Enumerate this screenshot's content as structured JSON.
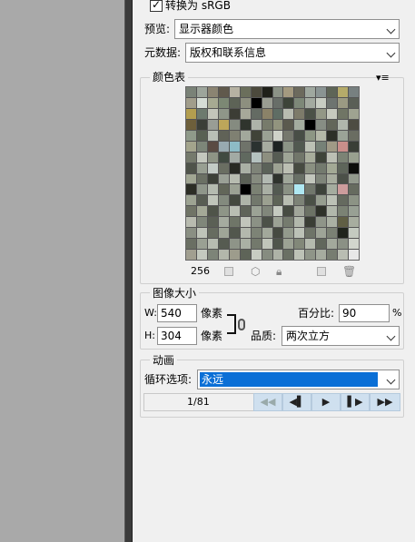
{
  "convert": {
    "label": "转换为 sRGB",
    "checked": "✓"
  },
  "preview": {
    "label": "预览:",
    "value": "显示器颜色"
  },
  "metadata": {
    "label": "元数据:",
    "value": "版权和联系信息"
  },
  "colorTable": {
    "title": "颜色表",
    "menuIcon": "≡",
    "count": "256",
    "colors": [
      "#7a8277",
      "#9da59b",
      "#8b8472",
      "#60594c",
      "#b6b2a2",
      "#6b6f5c",
      "#4c4a3d",
      "#1f2019",
      "#8b9286",
      "#a49a80",
      "#6c6a5d",
      "#9fa89f",
      "#8a9493",
      "#5e6557",
      "#b5ab6a",
      "#778080",
      "#a19d8b",
      "#d6ddd6",
      "#a7aa92",
      "#7c8874",
      "#5d6356",
      "#8d8f7f",
      "#000000",
      "#9a9d92",
      "#686e68",
      "#3d4439",
      "#7d8878",
      "#a3aaa0",
      "#c8cdc3",
      "#6e7470",
      "#9b9a83",
      "#5a5f56",
      "#b39e4f",
      "#6d7a6e",
      "#c3c5ba",
      "#8f9689",
      "#3c3d35",
      "#a7a89a",
      "#646b63",
      "#8b8268",
      "#5f6d64",
      "#b8bcb1",
      "#7d7b6a",
      "#4b5147",
      "#939786",
      "#c6c9be",
      "#707565",
      "#9fa391",
      "#6d5f3b",
      "#3b3f38",
      "#999d95",
      "#bda65a",
      "#858b80",
      "#2f342d",
      "#aeb3a9",
      "#777b6b",
      "#92947e",
      "#5b5a4e",
      "#a4ac9f",
      "#000000",
      "#878d84",
      "#63665a",
      "#b0b6ac",
      "#4d4c42",
      "#8f9a8a",
      "#596154",
      "#b9bfb6",
      "#606257",
      "#7f8072",
      "#a2a89c",
      "#404338",
      "#9aa194",
      "#cfd3c9",
      "#75786d",
      "#484e46",
      "#8d9684",
      "#b4b8a8",
      "#2d2f28",
      "#9ba397",
      "#6a6d62",
      "#a3a48c",
      "#7d8679",
      "#5a4b43",
      "#98a9b0",
      "#8dbbc6",
      "#6f736a",
      "#2b3230",
      "#a6aba0",
      "#1d2322",
      "#8b9486",
      "#515950",
      "#bcc1b5",
      "#768177",
      "#a09a86",
      "#c98e8a",
      "#3a3e36",
      "#757a6c",
      "#c4c8be",
      "#8e9485",
      "#404a41",
      "#a2aaa4",
      "#60695f",
      "#b4c1bf",
      "#8d8f80",
      "#565c53",
      "#9ea596",
      "#71766a",
      "#a8ad9c",
      "#3e4339",
      "#bcbfb4",
      "#7c8375",
      "#99a08f",
      "#4f534a",
      "#989f92",
      "#c3cbc6",
      "#6a6e62",
      "#282a23",
      "#aab0a5",
      "#7e8378",
      "#5b6259",
      "#9da293",
      "#bcbfb3",
      "#474b41",
      "#8a9081",
      "#737a6e",
      "#a3a995",
      "#5e655a",
      "#0d0e0b",
      "#a1a693",
      "#6b7064",
      "#3c4038",
      "#9aa096",
      "#b7bcb0",
      "#5a5f55",
      "#868b7f",
      "#b2b9b2",
      "#2f332d",
      "#9fa699",
      "#697066",
      "#c2c6bc",
      "#7f857a",
      "#a8ad9f",
      "#4b5048",
      "#939a8d",
      "#2c2d25",
      "#8f968a",
      "#b5bbb0",
      "#626659",
      "#9ba193",
      "#000000",
      "#7b8173",
      "#a9afa4",
      "#535a51",
      "#8a9184",
      "#afe8f2",
      "#71776c",
      "#3d423a",
      "#a5ac9f",
      "#cc9c9c",
      "#666b5f",
      "#9da392",
      "#585d53",
      "#c0c5ba",
      "#838a7e",
      "#44493f",
      "#aeb4a8",
      "#72786c",
      "#9ba090",
      "#5e6457",
      "#b8bdb1",
      "#7d8377",
      "#4a5046",
      "#969d8f",
      "#bcc1b6",
      "#656a5f",
      "#8c9385",
      "#707466",
      "#a4a997",
      "#4f5449",
      "#8e9587",
      "#b9beb3",
      "#5f6459",
      "#9ba295",
      "#81877b",
      "#c5cac0",
      "#474c42",
      "#a1a69a",
      "#6c7265",
      "#2e3129",
      "#b1b7ab",
      "#7b8274",
      "#98a094",
      "#b8bbaf",
      "#80877a",
      "#5b6055",
      "#a5ab9f",
      "#6f7568",
      "#c1c5bb",
      "#8b9185",
      "#4c5148",
      "#9ca295",
      "#757b6e",
      "#b2b8ac",
      "#3a3e35",
      "#8f9589",
      "#aab0a3",
      "#605f44",
      "#a7ad9f",
      "#8a8f83",
      "#bfc4b9",
      "#676c60",
      "#9fa597",
      "#52574d",
      "#b3b8ad",
      "#7d8376",
      "#a2a89b",
      "#464a41",
      "#939a8c",
      "#bcc2b7",
      "#6e7468",
      "#9ea497",
      "#7b8174",
      "#20241c",
      "#c4cac0",
      "#6a6f63",
      "#9aa093",
      "#b7bcb1",
      "#565b51",
      "#8e9488",
      "#aab0a4",
      "#73796c",
      "#c0c5ba",
      "#4f554b",
      "#9ca294",
      "#828879",
      "#b4baae",
      "#61675c",
      "#a3a99c",
      "#8b9185",
      "#d2d6cd",
      "#a19f90",
      "#c4c9bf",
      "#7d8478",
      "#b3b7ab",
      "#9d9c8c",
      "#5e6458",
      "#c7ccc2",
      "#868c80",
      "#aeb3a7",
      "#6a7064",
      "#bdc2b6",
      "#8f9588",
      "#a6ac9f",
      "#777d71",
      "#b9bdb2",
      "#e8e8e8"
    ]
  },
  "tools": {
    "cube": "cube-icon",
    "lock": "lock-icon",
    "newColor": "new-color-icon",
    "trash": "trash-icon"
  },
  "imageSize": {
    "title": "图像大小",
    "wLabel": "W:",
    "wValue": "540",
    "hLabel": "H:",
    "hValue": "304",
    "unit": "像素",
    "percentLabel": "百分比:",
    "percentValue": "90",
    "percentUnit": "%",
    "qualityLabel": "品质:",
    "qualityValue": "两次立方"
  },
  "animation": {
    "title": "动画",
    "loopLabel": "循环选项:",
    "loopValue": "永远",
    "frameCounter": "1/81",
    "buttons": {
      "first": "◀◀",
      "prev": "◀▌",
      "play": "▶",
      "next": "▌▶",
      "last": "▶▶"
    }
  }
}
